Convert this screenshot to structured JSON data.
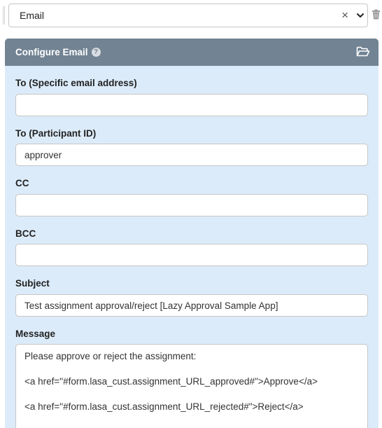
{
  "selector": {
    "value": "Email",
    "clear_glyph": "×"
  },
  "panel": {
    "title": "Configure Email",
    "help_glyph": "?",
    "fields": {
      "to_specific": {
        "label": "To (Specific email address)",
        "value": ""
      },
      "to_participant": {
        "label": "To (Participant ID)",
        "value": "approver"
      },
      "cc": {
        "label": "CC",
        "value": ""
      },
      "bcc": {
        "label": "BCC",
        "value": ""
      },
      "subject": {
        "label": "Subject",
        "value": "Test assignment approval/reject [Lazy Approval Sample App]"
      },
      "message": {
        "label": "Message",
        "lines": [
          "Please approve or reject the assignment:",
          "<a href=\"#form.lasa_cust.assignment_URL_approved#\">Approve</a>",
          "<a href=\"#form.lasa_cust.assignment_URL_rejected#\">Reject</a>"
        ]
      }
    }
  },
  "colors": {
    "panel_header": "#728393",
    "panel_body": "#dcebf9",
    "border": "#c6c6c6"
  },
  "icons": [
    "drag-handle-icon",
    "clear-icon",
    "chevron-down-icon",
    "trash-icon",
    "help-icon",
    "folder-open-icon"
  ]
}
